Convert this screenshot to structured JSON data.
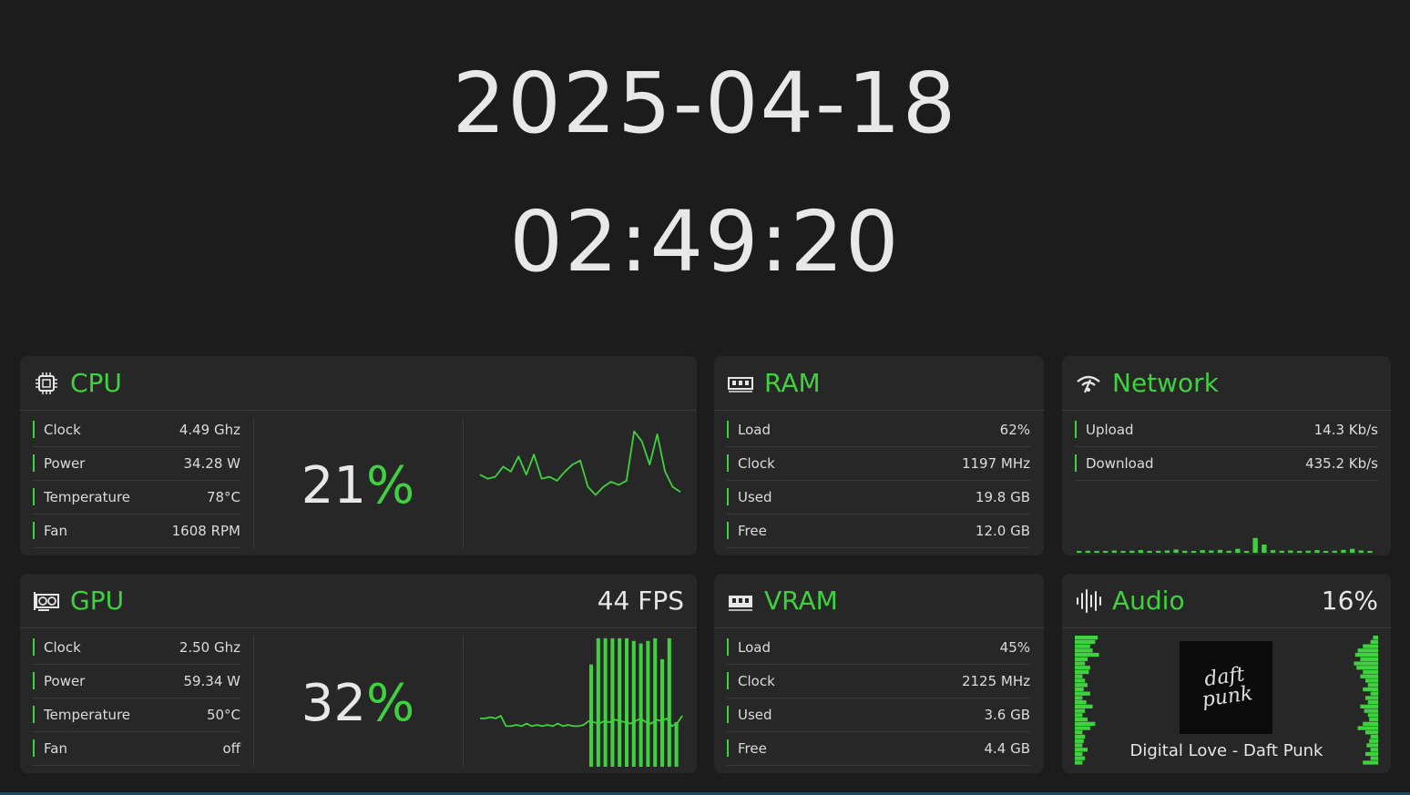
{
  "clock": {
    "date": "2025-04-18",
    "time": "02:49:20"
  },
  "accent_color": "#3fd23f",
  "cpu": {
    "title": "CPU",
    "icon": "cpu-chip-icon",
    "stats": [
      {
        "label": "Clock",
        "value": "4.49 Ghz"
      },
      {
        "label": "Power",
        "value": "34.28 W"
      },
      {
        "label": "Temperature",
        "value": "78°C"
      },
      {
        "label": "Fan",
        "value": "1608 RPM"
      }
    ],
    "load_number": "21",
    "load_sign": "%",
    "history": [
      0.52,
      0.48,
      0.5,
      0.6,
      0.55,
      0.7,
      0.52,
      0.72,
      0.48,
      0.5,
      0.46,
      0.55,
      0.62,
      0.66,
      0.4,
      0.32,
      0.4,
      0.45,
      0.42,
      0.46,
      0.95,
      0.85,
      0.62,
      0.92,
      0.55,
      0.4,
      0.35
    ]
  },
  "ram": {
    "title": "RAM",
    "icon": "ram-module-icon",
    "stats": [
      {
        "label": "Load",
        "value": "62%"
      },
      {
        "label": "Clock",
        "value": "1197 MHz"
      },
      {
        "label": "Used",
        "value": "19.8 GB"
      },
      {
        "label": "Free",
        "value": "12.0 GB"
      }
    ]
  },
  "network": {
    "title": "Network",
    "icon": "wifi-icon",
    "stats": [
      {
        "label": "Upload",
        "value": "14.3 Kb/s"
      },
      {
        "label": "Download",
        "value": "435.2 Kb/s"
      }
    ],
    "history": [
      0.05,
      0.06,
      0.04,
      0.05,
      0.07,
      0.05,
      0.06,
      0.08,
      0.05,
      0.06,
      0.07,
      0.1,
      0.06,
      0.05,
      0.08,
      0.07,
      0.09,
      0.06,
      0.12,
      0.05,
      0.45,
      0.25,
      0.08,
      0.06,
      0.07,
      0.05,
      0.06,
      0.08,
      0.05,
      0.06,
      0.09,
      0.12,
      0.07,
      0.05
    ]
  },
  "gpu": {
    "title": "GPU",
    "icon": "graphics-card-icon",
    "fps": "44 FPS",
    "stats": [
      {
        "label": "Clock",
        "value": "2.50 Ghz"
      },
      {
        "label": "Power",
        "value": "59.34 W"
      },
      {
        "label": "Temperature",
        "value": "50°C"
      },
      {
        "label": "Fan",
        "value": "off"
      }
    ],
    "load_number": "32",
    "load_sign": "%",
    "history": [
      0.36,
      0.36,
      0.37,
      0.36,
      0.38,
      0.3,
      0.3,
      0.31,
      0.3,
      0.32,
      0.3,
      0.31,
      0.3,
      0.31,
      0.3,
      0.32,
      0.3,
      0.31,
      0.3,
      0.3,
      0.31,
      0.34,
      0.33,
      0.32,
      0.34,
      0.33,
      0.35,
      0.34,
      0.33,
      0.32,
      0.34,
      0.36,
      0.33,
      0.32,
      0.35,
      0.34,
      0.36,
      0.3,
      0.32,
      0.38
    ],
    "bars": [
      0.78,
      0.98,
      0.98,
      0.98,
      0.98,
      0.98,
      0.96,
      0.94,
      0.96,
      0.98,
      0.82,
      0.98,
      0.34
    ]
  },
  "vram": {
    "title": "VRAM",
    "icon": "memory-icon",
    "stats": [
      {
        "label": "Load",
        "value": "45%"
      },
      {
        "label": "Clock",
        "value": "2125 MHz"
      },
      {
        "label": "Used",
        "value": "3.6 GB"
      },
      {
        "label": "Free",
        "value": "4.4 GB"
      }
    ]
  },
  "audio": {
    "title": "Audio",
    "icon": "audio-waveform-icon",
    "volume": "16%",
    "album_art_text": "daft punk",
    "track": "Digital Love - Daft Punk",
    "left_levels": [
      0.9,
      0.8,
      0.6,
      0.7,
      0.95,
      0.5,
      0.4,
      0.6,
      0.55,
      0.3,
      0.4,
      0.5,
      0.35,
      0.6,
      0.3,
      0.45,
      0.7,
      0.4,
      0.3,
      0.5,
      0.8,
      0.6,
      0.3,
      0.4,
      0.35,
      0.3,
      0.5,
      0.3,
      0.4,
      0.3
    ],
    "right_levels": [
      0.2,
      0.3,
      0.6,
      0.8,
      0.9,
      0.7,
      0.95,
      0.85,
      0.6,
      0.7,
      0.5,
      0.4,
      0.6,
      0.3,
      0.5,
      0.4,
      0.7,
      0.55,
      0.4,
      0.35,
      0.6,
      0.8,
      0.5,
      0.3,
      0.35,
      0.45,
      0.3,
      0.5,
      0.3,
      0.6
    ]
  }
}
